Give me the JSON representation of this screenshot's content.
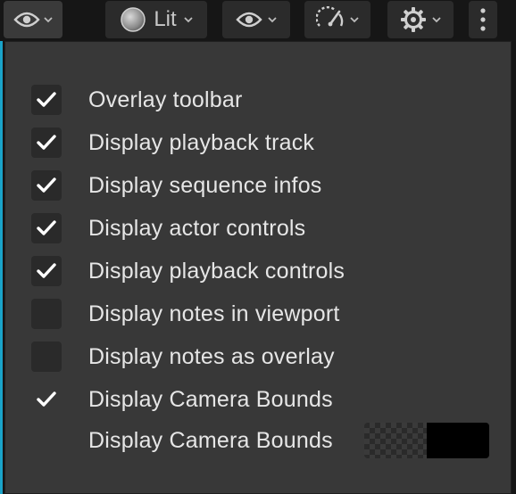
{
  "toolbar": {
    "lit_label": "Lit"
  },
  "menu": {
    "items": [
      {
        "label": "Overlay toolbar",
        "checked": true
      },
      {
        "label": "Display playback track",
        "checked": true
      },
      {
        "label": "Display sequence infos",
        "checked": true
      },
      {
        "label": "Display actor controls",
        "checked": true
      },
      {
        "label": "Display playback controls",
        "checked": true
      },
      {
        "label": "Display notes in viewport",
        "checked": false
      },
      {
        "label": "Display notes as overlay",
        "checked": false
      },
      {
        "label": "Display Camera Bounds",
        "checked": true
      }
    ],
    "color_row": {
      "label": "Display Camera Bounds",
      "swatch_color": "#000000"
    }
  },
  "colors": {
    "menu_bg": "#383838",
    "toolbar_bg": "#161616",
    "accent": "#1aa3c9",
    "text": "#e6e6e6"
  },
  "icons": {
    "view_options": "eye-icon",
    "lit_mode": "sphere-icon",
    "show_flags": "eye-icon",
    "performance": "gauge-icon",
    "settings": "gear-icon",
    "more": "vertical-dots-icon",
    "dropdown": "chevron-down-icon",
    "checked": "checkmark-icon"
  }
}
